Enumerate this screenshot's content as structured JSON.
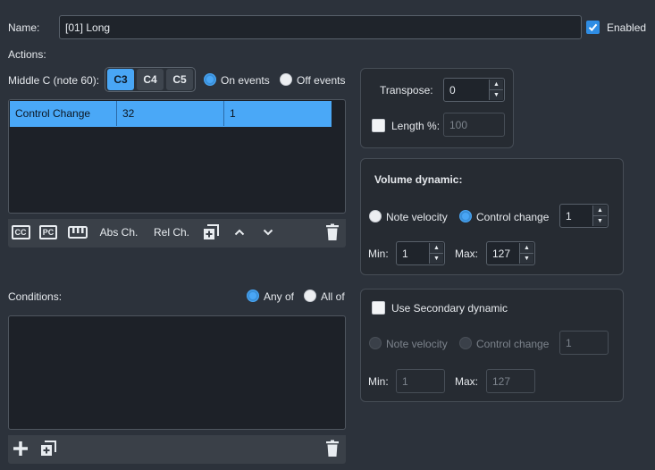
{
  "name_row": {
    "label": "Name:",
    "value": "[01] Long",
    "enabled_label": "Enabled",
    "enabled_checked": true
  },
  "actions": {
    "label": "Actions:",
    "middle_c_label": "Middle C (note 60):",
    "octave_buttons": [
      "C3",
      "C4",
      "C5"
    ],
    "octave_selected": "C3",
    "on_events_label": "On events",
    "off_events_label": "Off events",
    "event_mode": "on",
    "rows": [
      {
        "type": "Control Change",
        "param1": "32",
        "param2": "1"
      }
    ],
    "toolbar": {
      "cc_label": "CC",
      "pc_label": "PC",
      "abs_ch_label": "Abs Ch.",
      "rel_ch_label": "Rel Ch."
    }
  },
  "transpose_panel": {
    "transpose_label": "Transpose:",
    "transpose_value": "0",
    "length_label": "Length %:",
    "length_checked": false,
    "length_value": "100"
  },
  "volume_panel": {
    "title": "Volume dynamic:",
    "note_velocity_label": "Note velocity",
    "control_change_label": "Control change",
    "mode": "control_change",
    "cc_value": "1",
    "min_label": "Min:",
    "min_value": "1",
    "max_label": "Max:",
    "max_value": "127"
  },
  "secondary_panel": {
    "title": "Use Secondary dynamic",
    "checked": false,
    "note_velocity_label": "Note velocity",
    "control_change_label": "Control change",
    "cc_value": "1",
    "min_label": "Min:",
    "min_value": "1",
    "max_label": "Max:",
    "max_value": "127"
  },
  "conditions": {
    "label": "Conditions:",
    "any_of_label": "Any of",
    "all_of_label": "All of",
    "mode": "any"
  },
  "colors": {
    "background": "#2c323b",
    "accent": "#49a6f5",
    "selected_row": "#4aa8f7"
  }
}
